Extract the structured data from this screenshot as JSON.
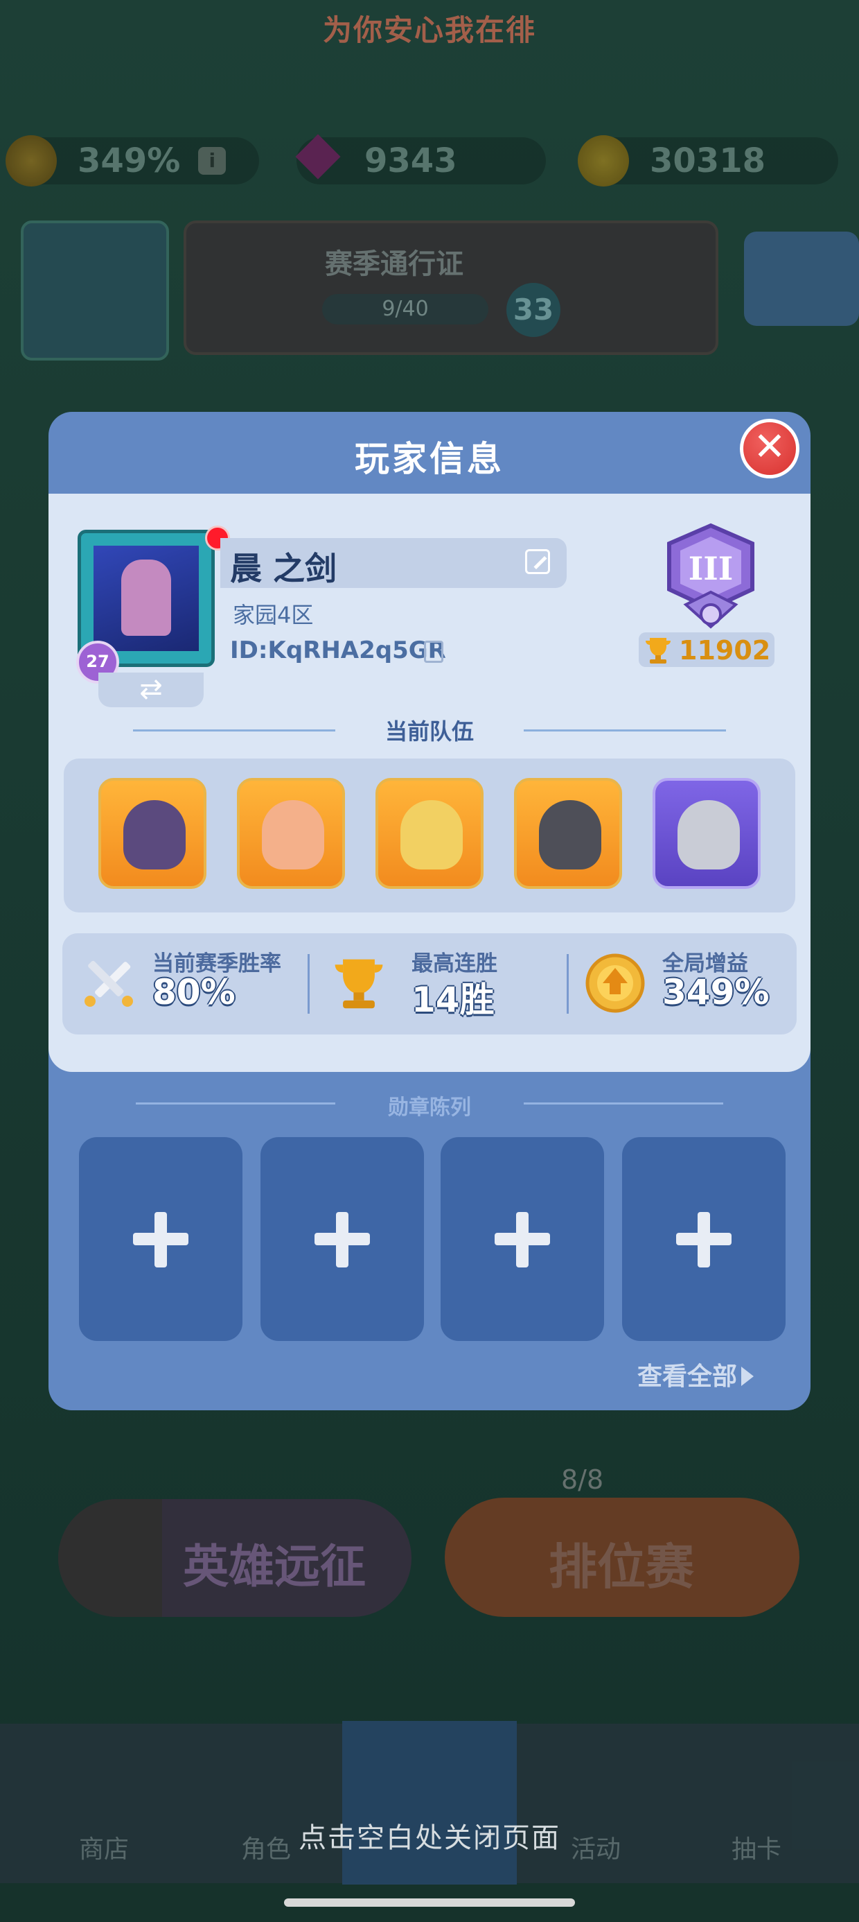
{
  "banner": {
    "text": "为你安心我在徘"
  },
  "resources": [
    {
      "icon": "boost-icon",
      "value": "349%"
    },
    {
      "icon": "gem-icon",
      "value": "9343"
    },
    {
      "icon": "coin-icon",
      "value": "30318"
    }
  ],
  "background": {
    "avatar_level": "27",
    "season_pass": {
      "title": "赛季通行证",
      "progress": "9/40",
      "level": "33"
    },
    "expedition_label": "英雄远征",
    "ranked": {
      "label": "排位赛",
      "count": "8/8"
    },
    "nav": [
      "商店",
      "角色",
      "活动",
      "抽卡"
    ]
  },
  "modal": {
    "title": "玩家信息",
    "player": {
      "name": "晨 之剑",
      "zone": "家园4区",
      "id": "ID:KqRHA2q5GR",
      "level": "27",
      "trophies": "11902",
      "rank_tier": "III"
    },
    "team_label": "当前队伍",
    "team": [
      {
        "icon": "dark-knight-hero-icon",
        "frame": "gold"
      },
      {
        "icon": "king-hero-icon",
        "frame": "gold"
      },
      {
        "icon": "blonde-warrior-hero-icon",
        "frame": "gold"
      },
      {
        "icon": "armored-knight-hero-icon",
        "frame": "gold"
      },
      {
        "icon": "helmet-knight-hero-icon",
        "frame": "purple"
      }
    ],
    "stats": [
      {
        "label": "当前赛季胜率",
        "value": "80%",
        "icon": "crossed-swords-icon"
      },
      {
        "label": "最高连胜",
        "value": "14胜",
        "icon": "trophy-icon"
      },
      {
        "label": "全局增益",
        "value": "349%",
        "icon": "boost-icon"
      }
    ],
    "medals_label": "勋章陈列",
    "medal_slots": 4,
    "view_all": "查看全部"
  },
  "close_hint": "点击空白处关闭页面",
  "colors": {
    "modal": "#6288c3",
    "panel": "#dbe6f5",
    "close": "#d8322f",
    "trophy": "#d98f11"
  }
}
